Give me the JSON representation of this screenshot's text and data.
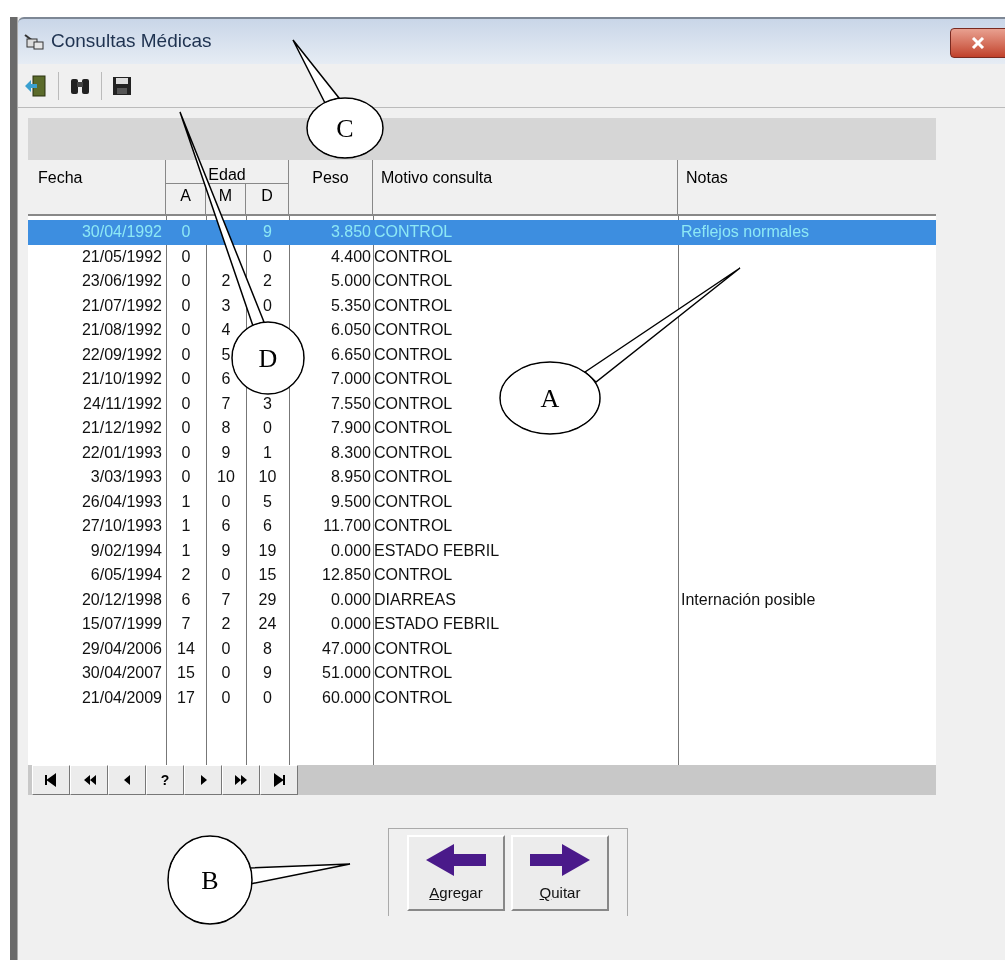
{
  "window": {
    "title": "Consultas Médicas"
  },
  "toolbar": [
    {
      "kind": "exit"
    },
    {
      "kind": "find"
    },
    {
      "kind": "save"
    }
  ],
  "table": {
    "columns": [
      "Fecha",
      "Edad",
      "Peso",
      "Motivo consulta",
      "Notas"
    ],
    "edad_subcolumns": [
      "A",
      "M",
      "D"
    ],
    "rows": [
      {
        "fecha": "30/04/1992",
        "a": "0",
        "d": "9",
        "peso": "3.850",
        "motivo": "CONTROL",
        "notas": "Reflejos normales",
        "selected": true
      },
      {
        "fecha": "21/05/1992",
        "a": "0",
        "d": "0",
        "peso": "4.400",
        "motivo": "CONTROL",
        "selected": false
      },
      {
        "fecha": "23/06/1992",
        "a": "0",
        "m": "2",
        "d": "2",
        "peso": "5.000",
        "motivo": "CONTROL",
        "selected": false
      },
      {
        "fecha": "21/07/1992",
        "a": "0",
        "m": "3",
        "d": "0",
        "peso": "5.350",
        "motivo": "CONTROL",
        "selected": false
      },
      {
        "fecha": "21/08/1992",
        "a": "0",
        "m": "4",
        "peso": "6.050",
        "motivo": "CONTROL",
        "selected": false
      },
      {
        "fecha": "22/09/1992",
        "a": "0",
        "m": "5",
        "peso": "6.650",
        "motivo": "CONTROL",
        "selected": false
      },
      {
        "fecha": "21/10/1992",
        "a": "0",
        "m": "6",
        "peso": "7.000",
        "motivo": "CONTROL",
        "selected": false
      },
      {
        "fecha": "24/11/1992",
        "a": "0",
        "m": "7",
        "d": "3",
        "peso": "7.550",
        "motivo": "CONTROL",
        "selected": false
      },
      {
        "fecha": "21/12/1992",
        "a": "0",
        "m": "8",
        "d": "0",
        "peso": "7.900",
        "motivo": "CONTROL",
        "selected": false
      },
      {
        "fecha": "22/01/1993",
        "a": "0",
        "m": "9",
        "d": "1",
        "peso": "8.300",
        "motivo": "CONTROL",
        "selected": false
      },
      {
        "fecha": "3/03/1993",
        "a": "0",
        "m": "10",
        "d": "10",
        "peso": "8.950",
        "motivo": "CONTROL",
        "selected": false
      },
      {
        "fecha": "26/04/1993",
        "a": "1",
        "m": "0",
        "d": "5",
        "peso": "9.500",
        "motivo": "CONTROL",
        "selected": false
      },
      {
        "fecha": "27/10/1993",
        "a": "1",
        "m": "6",
        "d": "6",
        "peso": "11.700",
        "motivo": "CONTROL",
        "selected": false
      },
      {
        "fecha": "9/02/1994",
        "a": "1",
        "m": "9",
        "d": "19",
        "peso": "0.000",
        "motivo": "ESTADO FEBRIL",
        "selected": false
      },
      {
        "fecha": "6/05/1994",
        "a": "2",
        "m": "0",
        "d": "15",
        "peso": "12.850",
        "motivo": "CONTROL",
        "selected": false
      },
      {
        "fecha": "20/12/1998",
        "a": "6",
        "m": "7",
        "d": "29",
        "peso": "0.000",
        "motivo": "DIARREAS",
        "notas": "Internación posible",
        "selected": false
      },
      {
        "fecha": "15/07/1999",
        "a": "7",
        "m": "2",
        "d": "24",
        "peso": "0.000",
        "motivo": "ESTADO FEBRIL",
        "selected": false
      },
      {
        "fecha": "29/04/2006",
        "a": "14",
        "m": "0",
        "d": "8",
        "peso": "47.000",
        "motivo": "CONTROL",
        "selected": false
      },
      {
        "fecha": "30/04/2007",
        "a": "15",
        "m": "0",
        "d": "9",
        "peso": "51.000",
        "motivo": "CONTROL",
        "selected": false
      },
      {
        "fecha": "21/04/2009",
        "a": "17",
        "m": "0",
        "d": "0",
        "peso": "60.000",
        "motivo": "CONTROL",
        "selected": false
      }
    ]
  },
  "navigator": [
    {
      "kind": "first"
    },
    {
      "kind": "prior_page"
    },
    {
      "kind": "prior"
    },
    {
      "kind": "text",
      "label": "?"
    },
    {
      "kind": "next"
    },
    {
      "kind": "next_page"
    },
    {
      "kind": "last"
    }
  ],
  "buttons": [
    {
      "kind": "left",
      "mnemonic": "A",
      "rest": "gregar"
    },
    {
      "kind": "right",
      "mnemonic": "Q",
      "rest": "uitar"
    }
  ],
  "callouts": [
    {
      "letter": "C"
    },
    {
      "letter": "D"
    },
    {
      "letter": "A"
    },
    {
      "letter": "B"
    }
  ]
}
